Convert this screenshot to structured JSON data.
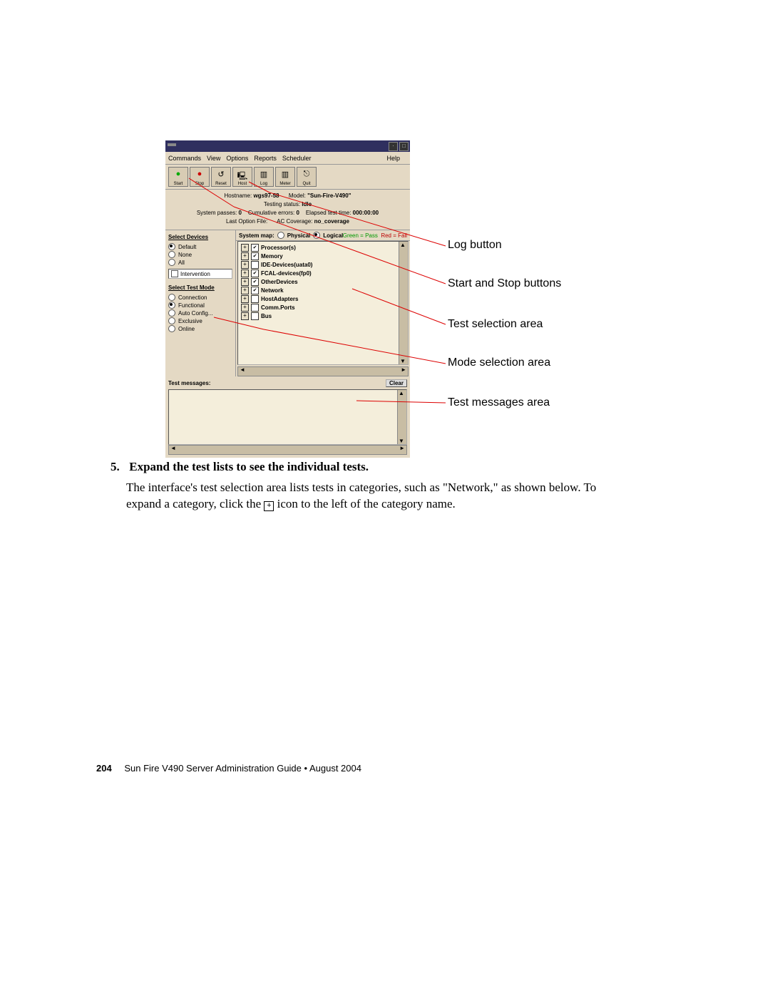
{
  "callouts": {
    "log": "Log button",
    "startstop": "Start and Stop buttons",
    "testsel": "Test selection area",
    "modesel": "Mode selection area",
    "msgs": "Test messages area"
  },
  "menu": {
    "commands": "Commands",
    "view": "View",
    "options": "Options",
    "reports": "Reports",
    "scheduler": "Scheduler",
    "help": "Help"
  },
  "toolbar": {
    "start": "Start",
    "stop": "Stop",
    "reset": "Reset",
    "host": "Host",
    "log": "Log",
    "meter": "Meter",
    "quit": "Quit"
  },
  "status": {
    "hostname_lbl": "Hostname:",
    "hostname": "wgs97-58",
    "model_lbl": "Model:",
    "model": "\"Sun-Fire-V490\"",
    "teststatus_lbl": "Testing status:",
    "teststatus": "idle",
    "passes_lbl": "System passes:",
    "passes": "0",
    "errors_lbl": "Cumulative errors:",
    "errors": "0",
    "elapsed_lbl": "Elapsed test time:",
    "elapsed": "000:00:00",
    "lastopt_lbl": "Last Option File:",
    "lastopt": "",
    "accov_lbl": "AC Coverage:",
    "accov": "no_coverage"
  },
  "left": {
    "sel_devices": "Select Devices",
    "default": "Default",
    "none": "None",
    "all": "All",
    "intervention": "Intervention",
    "sel_mode": "Select Test Mode",
    "connection": "Connection",
    "functional": "Functional",
    "auto": "Auto Config...",
    "exclusive": "Exclusive",
    "online": "Online"
  },
  "map": {
    "title": "System map:",
    "physical": "Physical",
    "logical": "Logical",
    "legend_g": "Green = Pass",
    "legend_r": "Red = Fail"
  },
  "tree": {
    "processors": "Processor(s)",
    "memory": "Memory",
    "ide": "IDE-Devices(uata0)",
    "fcal": "FCAL-devices(fp0)",
    "other": "OtherDevices",
    "network": "Network",
    "hostadapters": "HostAdapters",
    "commports": "Comm.Ports",
    "bus": "Bus"
  },
  "msgs": {
    "title": "Test messages:",
    "clear": "Clear"
  },
  "step": {
    "num": "5.",
    "title": "Expand the test lists to see the individual tests.",
    "p1a": "The interface's test selection area lists tests in categories, such as \"Network,\" as shown below. To expand a category, click the ",
    "p1b": " icon to the left of the category name."
  },
  "footer": {
    "page": "204",
    "text": "Sun Fire V490 Server Administration Guide • August 2004"
  }
}
